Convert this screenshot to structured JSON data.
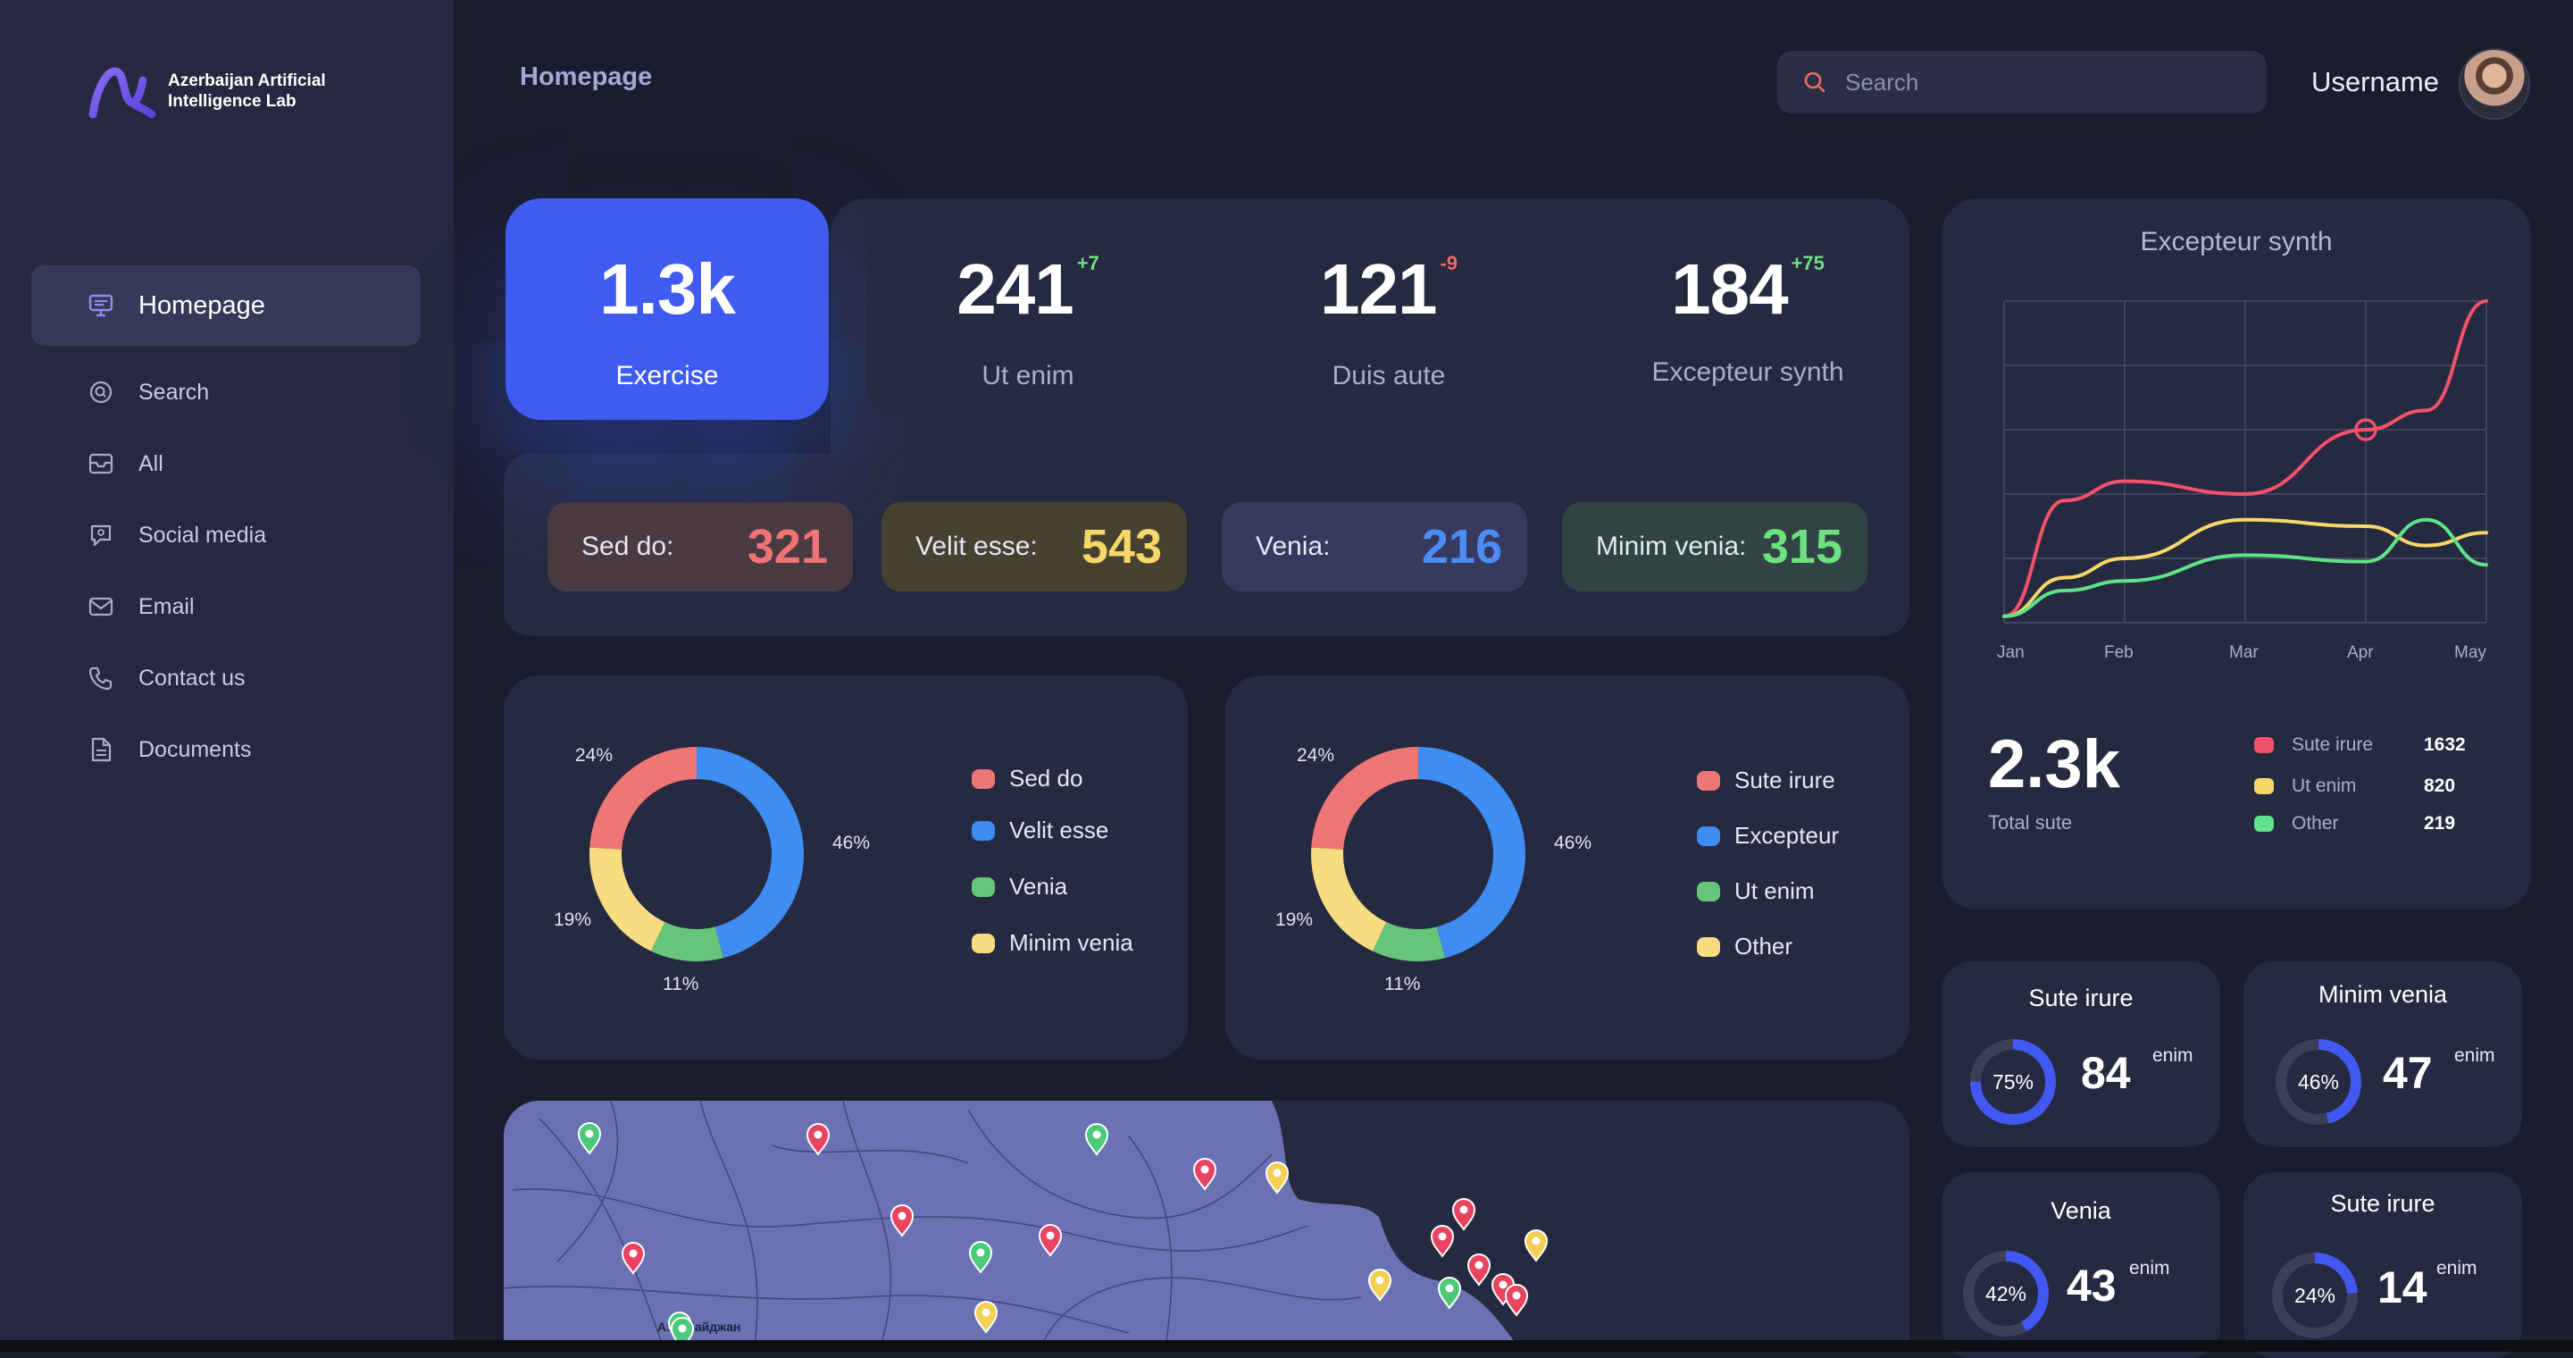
{
  "brand": {
    "name_line1": "Azerbaijan Artificial",
    "name_line2": "Intelligence Lab"
  },
  "sidebar": {
    "items": [
      {
        "label": "Homepage",
        "icon": "monitor-icon",
        "active": true
      },
      {
        "label": "Search",
        "icon": "search-circle-icon"
      },
      {
        "label": "All",
        "icon": "inbox-icon"
      },
      {
        "label": "Social media",
        "icon": "chat-bubble-icon"
      },
      {
        "label": "Email",
        "icon": "mail-icon"
      },
      {
        "label": "Contact us",
        "icon": "phone-icon"
      },
      {
        "label": "Documents",
        "icon": "document-icon"
      }
    ]
  },
  "header": {
    "title": "Homepage",
    "search_placeholder": "Search",
    "username": "Username"
  },
  "stats": [
    {
      "value": "1.3k",
      "label": "Exercise",
      "delta": ""
    },
    {
      "value": "241",
      "label": "Ut enim",
      "delta": "+7"
    },
    {
      "value": "121",
      "label": "Duis aute",
      "delta": "-9"
    },
    {
      "value": "184",
      "label": "Excepteur synth",
      "delta": "+75"
    }
  ],
  "pills": [
    {
      "label": "Sed do:",
      "value": "321",
      "color": "#f07474",
      "bg": "#4a3a42"
    },
    {
      "label": "Velit esse:",
      "value": "543",
      "color": "#f5d76a",
      "bg": "#46422f"
    },
    {
      "label": "Venia:",
      "value": "216",
      "color": "#4c8df5",
      "bg": "#363a5e"
    },
    {
      "label": "Minim venia:",
      "value": "315",
      "color": "#6ee07f",
      "bg": "#2f4443"
    }
  ],
  "donuts": [
    {
      "slices": [
        {
          "label": "Velit esse",
          "pct": "46%",
          "color": "#3f8cf2"
        },
        {
          "label": "Venia",
          "pct": "11%",
          "color": "#67c57a"
        },
        {
          "label": "Minim venia",
          "pct": "19%",
          "color": "#f7dd80"
        },
        {
          "label": "Sed do",
          "pct": "24%",
          "color": "#ef7676"
        }
      ],
      "legend": [
        "Sed do",
        "Velit esse",
        "Venia",
        "Minim venia"
      ]
    },
    {
      "slices": [
        {
          "label": "Excepteur",
          "pct": "46%",
          "color": "#3f8cf2"
        },
        {
          "label": "Ut enim",
          "pct": "11%",
          "color": "#67c57a"
        },
        {
          "label": "Other",
          "pct": "19%",
          "color": "#f7dd80"
        },
        {
          "label": "Sute irure",
          "pct": "24%",
          "color": "#ef7676"
        }
      ],
      "legend": [
        "Sute irure",
        "Excepteur",
        "Ut enim",
        "Other"
      ]
    }
  ],
  "chart_data": {
    "type": "line",
    "title": "Excepteur synth",
    "x": [
      "Jan",
      "Feb",
      "Mar",
      "Apr",
      "May"
    ],
    "ylim": [
      0,
      100
    ],
    "grid": true,
    "series": [
      {
        "name": "Sute irure",
        "color": "#f2526a",
        "values": [
          2,
          38,
          44,
          40,
          60,
          66,
          100
        ]
      },
      {
        "name": "Ut enim",
        "color": "#f5d76a",
        "values": [
          2,
          14,
          20,
          32,
          30,
          24,
          28
        ]
      },
      {
        "name": "Other",
        "color": "#5ee38a",
        "values": [
          2,
          10,
          13,
          21,
          19,
          32,
          18
        ]
      }
    ],
    "x_samples": [
      0,
      0.5,
      1,
      2,
      3,
      3.5,
      4
    ],
    "marker": {
      "series": "Sute irure",
      "x": "Apr"
    },
    "total": "2.3k",
    "total_label": "Total sute",
    "legend_values": [
      "1632",
      "820",
      "219"
    ]
  },
  "minis": [
    {
      "title": "Sute irure",
      "pct": "75%",
      "fraction": 0.75,
      "value": "84",
      "unit": "enim"
    },
    {
      "title": "Minim venia",
      "pct": "46%",
      "fraction": 0.46,
      "value": "47",
      "unit": "enim"
    },
    {
      "title": "Venia",
      "pct": "42%",
      "fraction": 0.42,
      "value": "43",
      "unit": "enim"
    },
    {
      "title": "Sute irure",
      "pct": "24%",
      "fraction": 0.24,
      "value": "14",
      "unit": "enim"
    }
  ],
  "map": {
    "label": "Азербайджан",
    "pins": [
      {
        "color": "green"
      },
      {
        "color": "red"
      },
      {
        "color": "green"
      },
      {
        "color": "red"
      },
      {
        "color": "yellow"
      },
      {
        "color": "red"
      },
      {
        "color": "red"
      },
      {
        "color": "green"
      },
      {
        "color": "red"
      },
      {
        "color": "red"
      },
      {
        "color": "yellow"
      },
      {
        "color": "red"
      },
      {
        "color": "red"
      },
      {
        "color": "yellow"
      },
      {
        "color": "green"
      },
      {
        "color": "red"
      },
      {
        "color": "red"
      },
      {
        "color": "yellow"
      },
      {
        "color": "green"
      },
      {
        "color": "green"
      }
    ]
  }
}
